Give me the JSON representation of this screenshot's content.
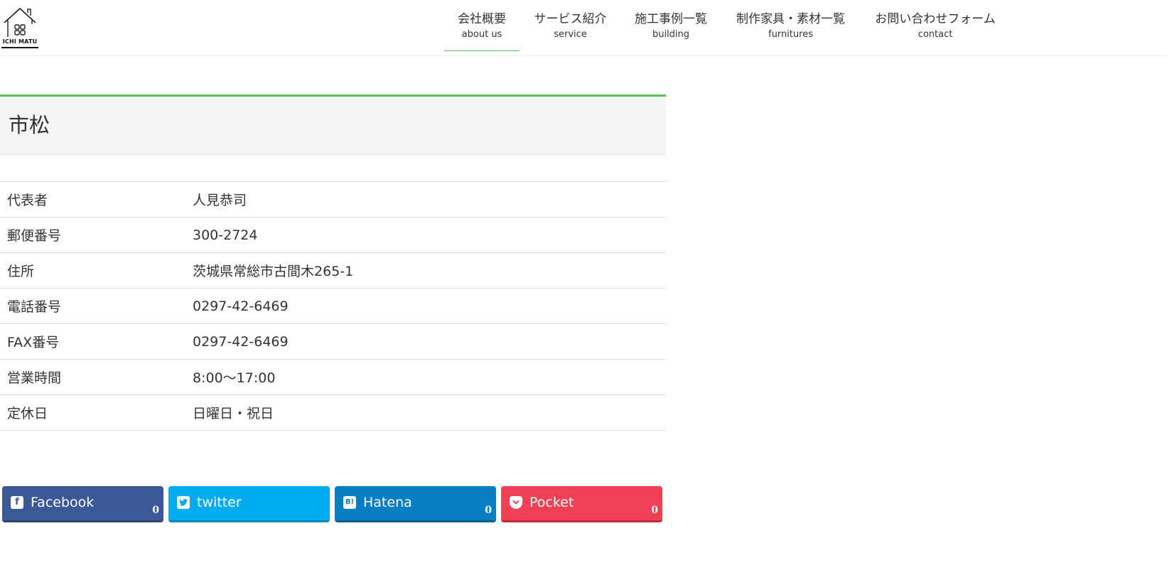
{
  "logo": {
    "text": "ICHI MATU",
    "icon": "house-logo-icon"
  },
  "nav": {
    "items": [
      {
        "jp": "会社概要",
        "en": "about us",
        "active": true
      },
      {
        "jp": "サービス紹介",
        "en": "service",
        "active": false
      },
      {
        "jp": "施工事例一覧",
        "en": "building",
        "active": false
      },
      {
        "jp": "制作家具・素材一覧",
        "en": "furnitures",
        "active": false
      },
      {
        "jp": "お問い合わせフォーム",
        "en": "contact",
        "active": false
      }
    ],
    "accent_color": "#51c754"
  },
  "page": {
    "title": "市松"
  },
  "info": {
    "rows": [
      {
        "label": "代表者",
        "value": "人見恭司"
      },
      {
        "label": "郵便番号",
        "value": "300-2724"
      },
      {
        "label": "住所",
        "value": "茨城県常総市古間木265-1"
      },
      {
        "label": "電話番号",
        "value": "0297-42-6469"
      },
      {
        "label": "FAX番号",
        "value": "0297-42-6469"
      },
      {
        "label": "営業時間",
        "value": "8:00～17:00"
      },
      {
        "label": "定休日",
        "value": "日曜日・祝日"
      }
    ]
  },
  "share": {
    "buttons": [
      {
        "label": "Facebook",
        "count": "0",
        "icon": "facebook-icon",
        "color": "#3b5998"
      },
      {
        "label": "twitter",
        "count": "",
        "icon": "twitter-icon",
        "color": "#00acee"
      },
      {
        "label": "Hatena",
        "count": "0",
        "icon": "hatena-icon",
        "color": "#0a7ec3"
      },
      {
        "label": "Pocket",
        "count": "0",
        "icon": "pocket-icon",
        "color": "#ef4056"
      }
    ]
  }
}
